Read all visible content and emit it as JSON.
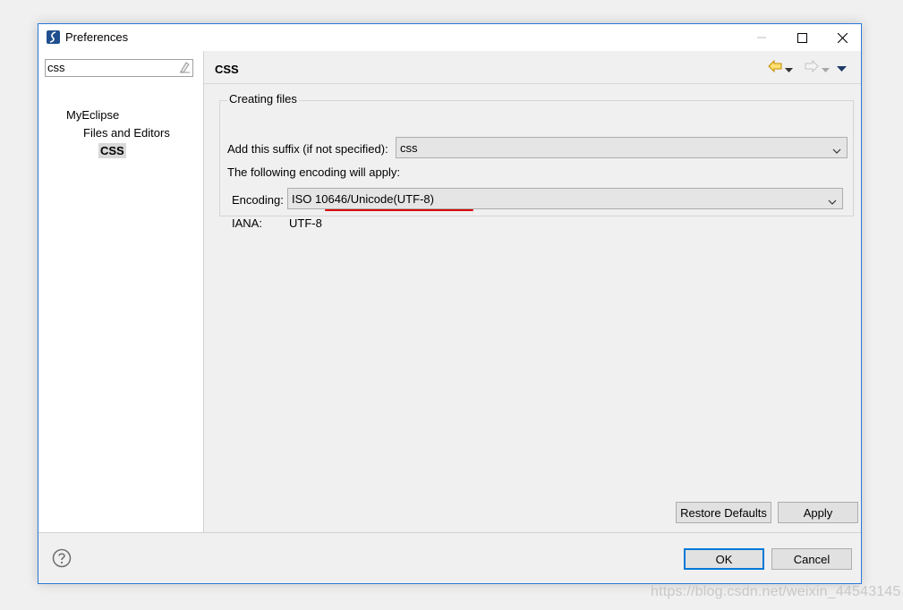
{
  "window": {
    "title": "Preferences"
  },
  "filter": {
    "value": "css"
  },
  "tree": {
    "items": [
      {
        "label": "MyEclipse"
      },
      {
        "label": "Files and Editors"
      },
      {
        "label": "CSS"
      }
    ]
  },
  "page": {
    "title": "CSS"
  },
  "creating_files": {
    "group_title": "Creating files",
    "suffix_label": "Add this suffix (if not specified):",
    "suffix_value": "css",
    "encoding_note": "The following encoding will apply:",
    "encoding_label": "Encoding:",
    "encoding_value": "ISO 10646/Unicode(UTF-8)",
    "iana_label": "IANA:",
    "iana_value": "UTF-8"
  },
  "buttons": {
    "restore_defaults": "Restore Defaults",
    "apply": "Apply",
    "ok": "OK",
    "cancel": "Cancel"
  },
  "watermark": "https://blog.csdn.net/weixin_44543145",
  "colors": {
    "accent": "#0078d7",
    "highlight_underline": "#d90000",
    "back_arrow": "#e0a800"
  },
  "icons": [
    "app-icon",
    "minimize-icon",
    "maximize-icon",
    "close-icon",
    "clear-filter-icon",
    "back-arrow-icon",
    "forward-arrow-icon",
    "dropdown-icon",
    "view-menu-icon",
    "help-icon"
  ]
}
